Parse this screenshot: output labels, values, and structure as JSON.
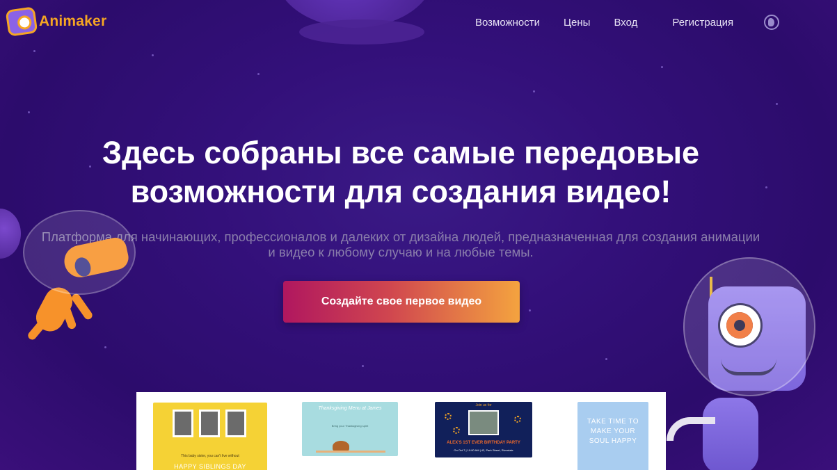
{
  "brand": {
    "name": "Animaker",
    "accent": "#f6a623",
    "background": "#2f0e72"
  },
  "nav": {
    "items": [
      {
        "label": "Возможности"
      },
      {
        "label": "Цены"
      },
      {
        "label": "Вход"
      },
      {
        "label": "Регистрация"
      }
    ],
    "globe_icon": "globe-icon"
  },
  "hero": {
    "title_line1": "Здесь собраны все самые передовые",
    "title_line2": "возможности для создания видео!",
    "subtitle_line1": "Платформа для начинающих, профессионалов и далеких от дизайна людей, предназначенная для создания анимации",
    "subtitle_line2": "и видео к любому случаю и на любые темы.",
    "cta_label": "Создайте свое первое видео"
  },
  "templates": [
    {
      "small_text": "This baby sister, you can't live without",
      "big_text": "HAPPY SIBLINGS DAY"
    },
    {
      "title": "Thanksgiving Menu at James",
      "sub": "Bring your Thanksgiving spirit"
    },
    {
      "top": "Join us for",
      "main": "ALEX'S 1ST EVER BIRTHDAY PARTY",
      "foot": "On Oct 7 | 10:00 AM | 42, Park Street, Riverdale"
    },
    {
      "text_line1": "TAKE TIME TO",
      "text_line2": "MAKE YOUR",
      "text_line3": "SOUL HAPPY"
    }
  ]
}
